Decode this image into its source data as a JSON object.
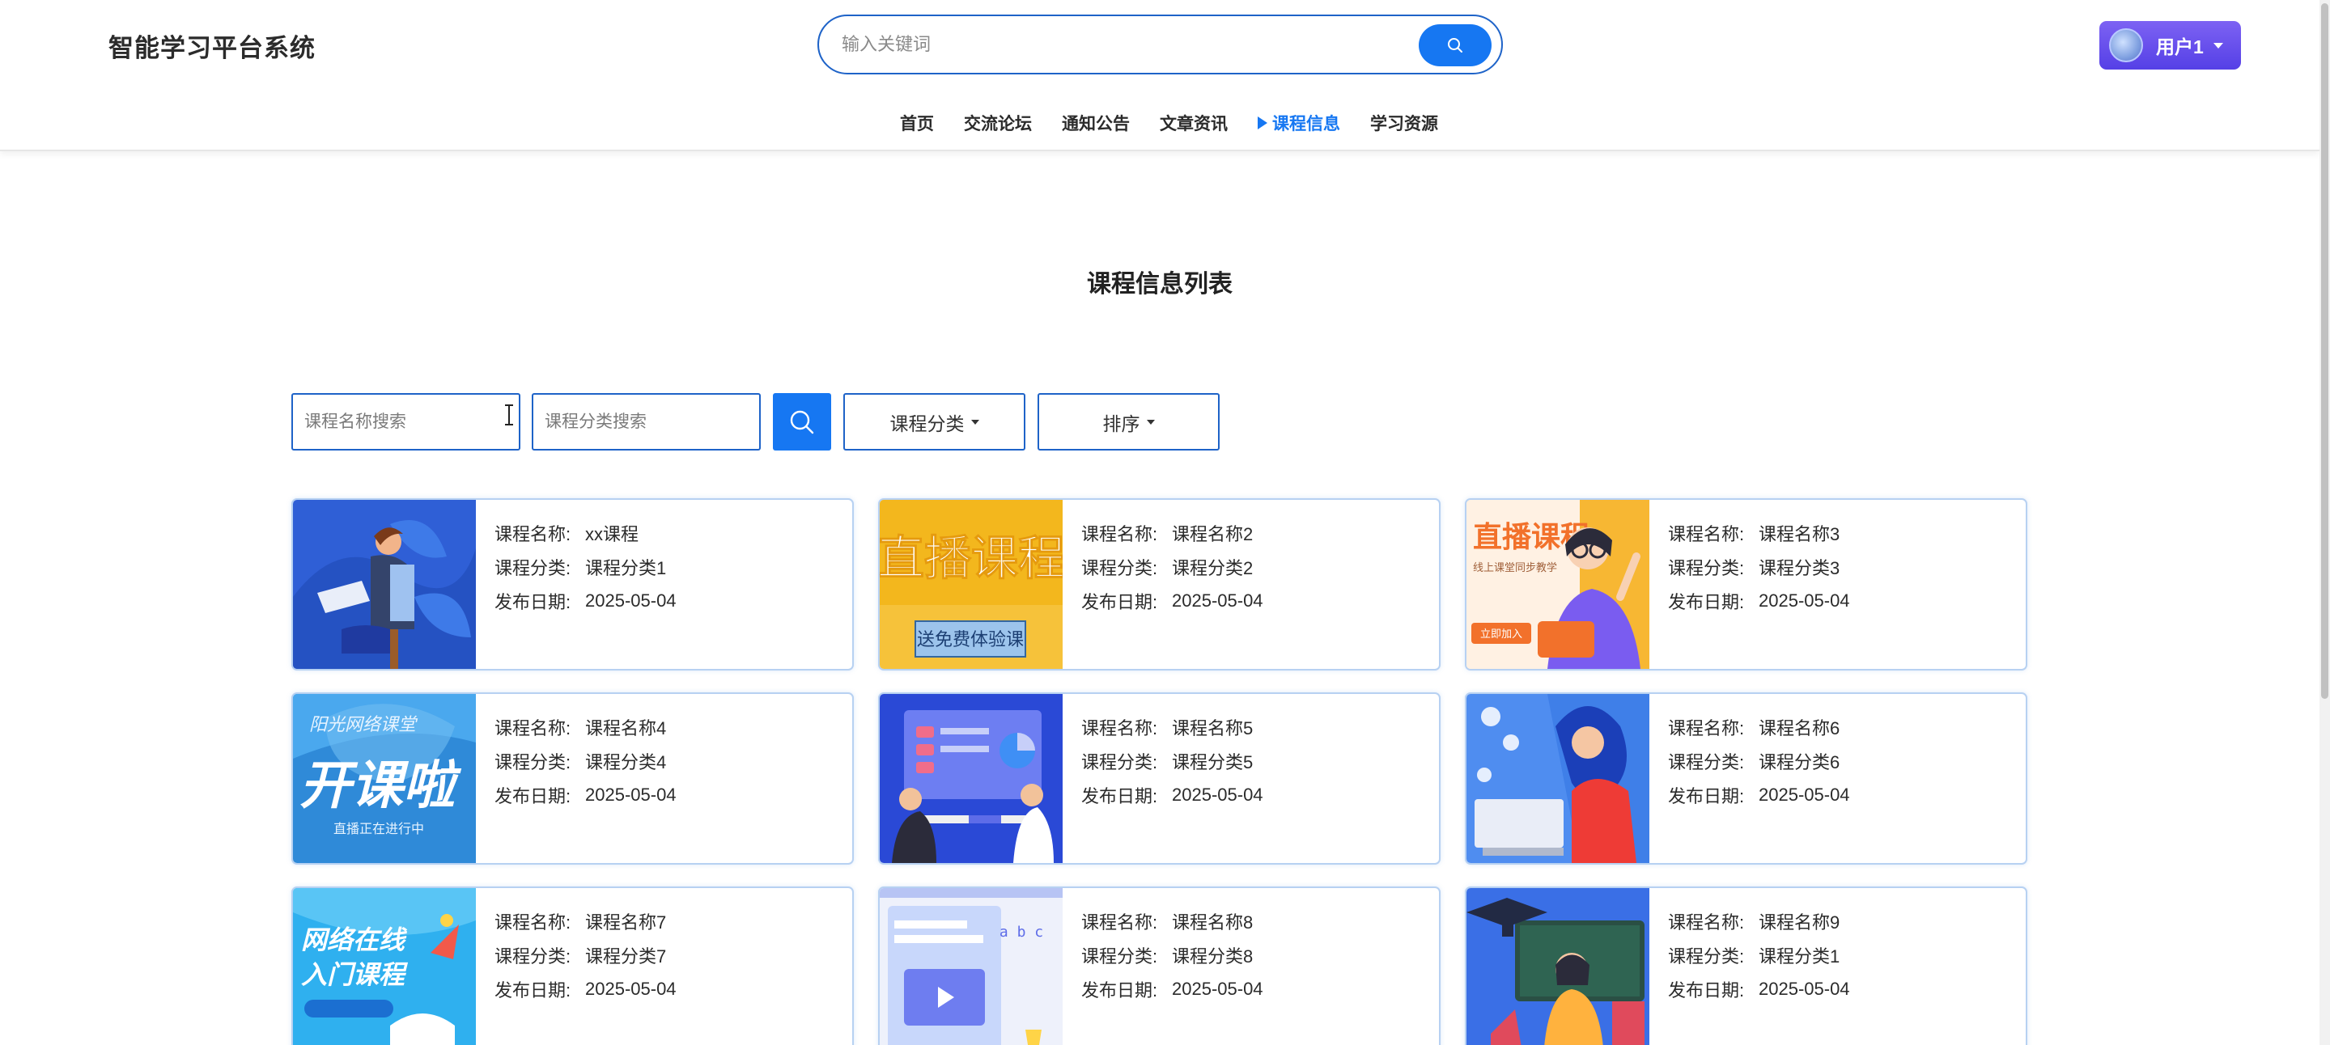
{
  "header": {
    "brand": "智能学习平台系统",
    "search_placeholder": "输入关键词",
    "user_name": "用户1"
  },
  "nav": {
    "items": [
      {
        "label": "首页",
        "active": false
      },
      {
        "label": "交流论坛",
        "active": false
      },
      {
        "label": "通知公告",
        "active": false
      },
      {
        "label": "文章资讯",
        "active": false
      },
      {
        "label": "课程信息",
        "active": true
      },
      {
        "label": "学习资源",
        "active": false
      }
    ]
  },
  "page_title": "课程信息列表",
  "filters": {
    "name_placeholder": "课程名称搜索",
    "category_placeholder": "课程分类搜索",
    "category_dropdown": "课程分类",
    "sort_dropdown": "排序"
  },
  "labels": {
    "name": "课程名称:",
    "category": "课程分类:",
    "date": "发布日期:"
  },
  "courses": [
    {
      "name": "xx课程",
      "category": "课程分类1",
      "date": "2025-05-04"
    },
    {
      "name": "课程名称2",
      "category": "课程分类2",
      "date": "2025-05-04"
    },
    {
      "name": "课程名称3",
      "category": "课程分类3",
      "date": "2025-05-04"
    },
    {
      "name": "课程名称4",
      "category": "课程分类4",
      "date": "2025-05-04"
    },
    {
      "name": "课程名称5",
      "category": "课程分类5",
      "date": "2025-05-04"
    },
    {
      "name": "课程名称6",
      "category": "课程分类6",
      "date": "2025-05-04"
    },
    {
      "name": "课程名称7",
      "category": "课程分类7",
      "date": "2025-05-04"
    },
    {
      "name": "课程名称8",
      "category": "课程分类8",
      "date": "2025-05-04"
    },
    {
      "name": "课程名称9",
      "category": "课程分类1",
      "date": "2025-05-04"
    }
  ],
  "thumb_text": {
    "t2_title": "直播课程",
    "t2_sub": "送免费体验课",
    "t3_title": "直播课程",
    "t3_sub": "线上课堂同步教学",
    "t3_btn": "立即加入",
    "t4_top": "阳光网络课堂",
    "t4_big": "开课啦",
    "t4_sub": "直播正在进行中",
    "t7_line1": "网络在线",
    "t7_line2": "入门课程",
    "t8_text": "a b c"
  },
  "colors": {
    "primary": "#1677f2",
    "border": "#1e63c8",
    "card_border": "#b7d1f2",
    "user_gradient_top": "#7d62f3",
    "user_gradient_bottom": "#5540e6"
  },
  "icons": {
    "search": "search-icon",
    "caret": "caret-down-icon"
  }
}
